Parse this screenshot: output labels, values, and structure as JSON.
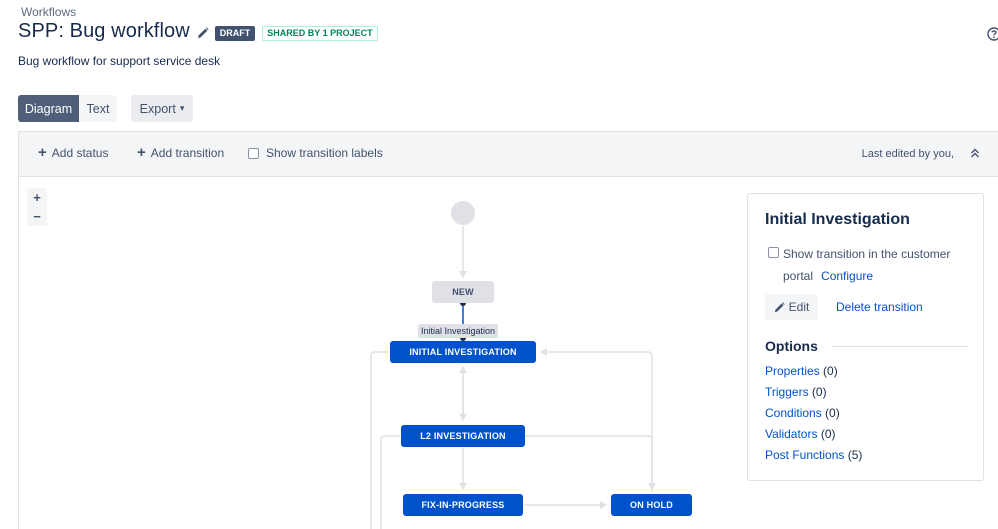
{
  "breadcrumb": "Workflows",
  "header": {
    "title": "SPP: Bug workflow",
    "draft_badge": "DRAFT",
    "shared_badge": "SHARED BY 1 PROJECT",
    "description": "Bug workflow for support service desk"
  },
  "view_tabs": {
    "diagram": "Diagram",
    "text": "Text",
    "export": "Export"
  },
  "toolbar": {
    "add_status": "Add status",
    "add_transition": "Add transition",
    "show_labels": "Show transition labels",
    "show_labels_checked": false,
    "last_edited": "Last edited by you,"
  },
  "zoom": {
    "in": "+",
    "out": "−"
  },
  "diagram": {
    "statuses": {
      "new": "NEW",
      "initial_investigation": "INITIAL INVESTIGATION",
      "l2_investigation": "L2 INVESTIGATION",
      "fix_in_progress": "FIX-IN-PROGRESS",
      "on_hold": "ON HOLD"
    },
    "selected_transition_label": "Initial Investigation"
  },
  "panel": {
    "title": "Initial Investigation",
    "portal_checkbox_label": "Show transition in the customer portal",
    "portal_checkbox_checked": false,
    "configure_link": "Configure",
    "edit_button": "Edit",
    "delete_link": "Delete transition",
    "options_heading": "Options",
    "options": [
      {
        "label": "Properties",
        "count": "(0)"
      },
      {
        "label": "Triggers",
        "count": "(0)"
      },
      {
        "label": "Conditions",
        "count": "(0)"
      },
      {
        "label": "Validators",
        "count": "(0)"
      },
      {
        "label": "Post Functions",
        "count": "(5)"
      }
    ]
  },
  "colors": {
    "primary_blue": "#0052cc",
    "draft_lozenge": "#42526e",
    "shared_green": "#00875a",
    "toolbar_bg": "#f4f5f7"
  }
}
